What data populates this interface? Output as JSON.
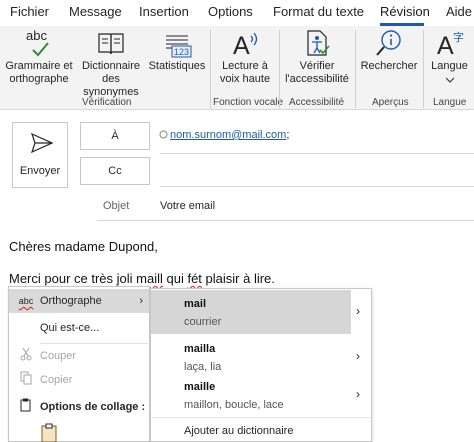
{
  "ribbon": {
    "tabs": [
      "Fichier",
      "Message",
      "Insertion",
      "Options",
      "Format du texte",
      "Révision",
      "Aide"
    ],
    "active_tab": "Révision",
    "buttons": {
      "spelling": "Grammaire et orthographe",
      "thesaurus": "Dictionnaire des synonymes",
      "stats": "Statistiques",
      "read_aloud": "Lecture à voix haute",
      "accessibility": "Vérifier l'accessibilité",
      "search": "Rechercher",
      "language": "Langue"
    },
    "groups": {
      "verification": "Vérification",
      "voice": "Fonction vocale",
      "accessibility": "Accessibilité",
      "overview": "Aperçus",
      "language": "Langue"
    },
    "stats_icon_text": "123",
    "spelling_icon_text": "abc"
  },
  "compose": {
    "send_label": "Envoyer",
    "to_label": "À",
    "cc_label": "Cc",
    "recipient": "nom.surnom@mail.com",
    "recipient_sep": ";",
    "subject_label": "Objet",
    "subject_value": "Votre email"
  },
  "body": {
    "greeting": "Chères madame Dupond,",
    "line_before": "Merci pour ce très joli ",
    "misspelled": "maill",
    "line_mid": " qui ",
    "misspelled2": "fét",
    "line_after": " plaisir à lire."
  },
  "context_menu": {
    "spelling": "Orthographe",
    "spelling_icon_text": "abc",
    "who_is": "Qui est-ce...",
    "cut": "Couper",
    "copy": "Copier",
    "paste_options": "Options de collage :"
  },
  "suggestions": [
    {
      "word": "mail",
      "detail": "courrier"
    },
    {
      "word": "mailla",
      "detail": "laça, lia"
    },
    {
      "word": "maille",
      "detail": "maillon, boucle, lace"
    }
  ],
  "add_to_dictionary": "Ajouter au dictionnaire"
}
